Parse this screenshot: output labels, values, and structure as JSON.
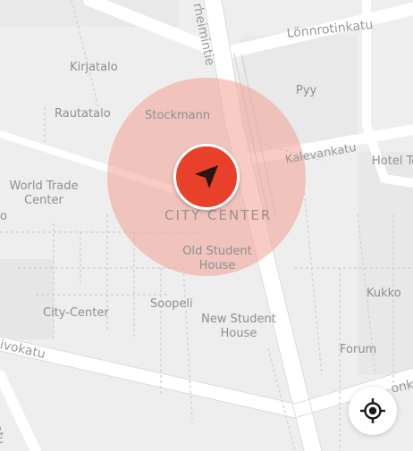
{
  "map": {
    "area_label": "CITY CENTER",
    "pois": {
      "kirjatalo": "Kirjatalo",
      "rautatalo": "Rautatalo",
      "stockmann": "Stockmann",
      "pyy": "Pyy",
      "world_trade_center_line1": "World Trade",
      "world_trade_center_line2": "Center",
      "hotel": "Hotel To",
      "old_student_house_line1": "Old Student",
      "old_student_house_line2": "House",
      "kukko": "Kukko",
      "city_center_mall": "City-Center",
      "soopeli": "Soopeli",
      "new_student_house_line1": "New Student",
      "new_student_house_line2": "House",
      "forum": "Forum",
      "fragment_o": "o"
    },
    "streets": {
      "lonnrotinkatu": "Lönnrotinkatu",
      "kalevankatu": "Kalevankatu",
      "mannerheimintie": "rheimintie",
      "esplanadi": "ivokatu",
      "bottom_right": "onk",
      "bottom_left": "atu"
    }
  },
  "controls": {
    "location_marker_icon": "navigation-arrow-icon",
    "locate_button_icon": "crosshair-icon",
    "marker_color": "#e8402a",
    "radius_color": "#f3a096"
  }
}
